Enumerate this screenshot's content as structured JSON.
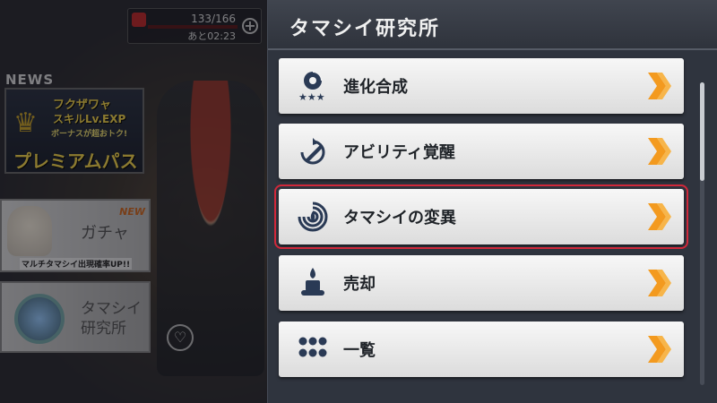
{
  "status": {
    "stamina": "133/166",
    "timer": "あと02:23",
    "plus": "+"
  },
  "home": {
    "news_label": "NEWS",
    "banner": {
      "line1": "フクザワャ",
      "line2": "スキルLv.EXP",
      "line3": "ボーナスが超おトク!",
      "line4": "プレミアムパス"
    },
    "gacha": {
      "badge": "NEW",
      "title": "ガチャ",
      "subtitle": "マルチタマシイ出現確率UP!!"
    },
    "lab": {
      "line1": "タマシイ",
      "line2": "研究所"
    },
    "heart_icon": "♡"
  },
  "panel": {
    "title": "タマシイ研究所",
    "items": [
      {
        "label": "進化合成",
        "icon": "evolution-icon",
        "selected": false
      },
      {
        "label": "アビリティ覚醒",
        "icon": "ability-awaken-icon",
        "selected": false
      },
      {
        "label": "タマシイの変異",
        "icon": "mutation-swirl-icon",
        "selected": true
      },
      {
        "label": "売却",
        "icon": "sell-candle-icon",
        "selected": false
      },
      {
        "label": "一覧",
        "icon": "list-grid-icon",
        "selected": false
      }
    ]
  },
  "colors": {
    "panel_bg": "#2f343e",
    "card_bg": "#ececec",
    "chevron": "#f39a1f",
    "selection": "#d0283a",
    "icon_dark": "#2a3a55"
  }
}
